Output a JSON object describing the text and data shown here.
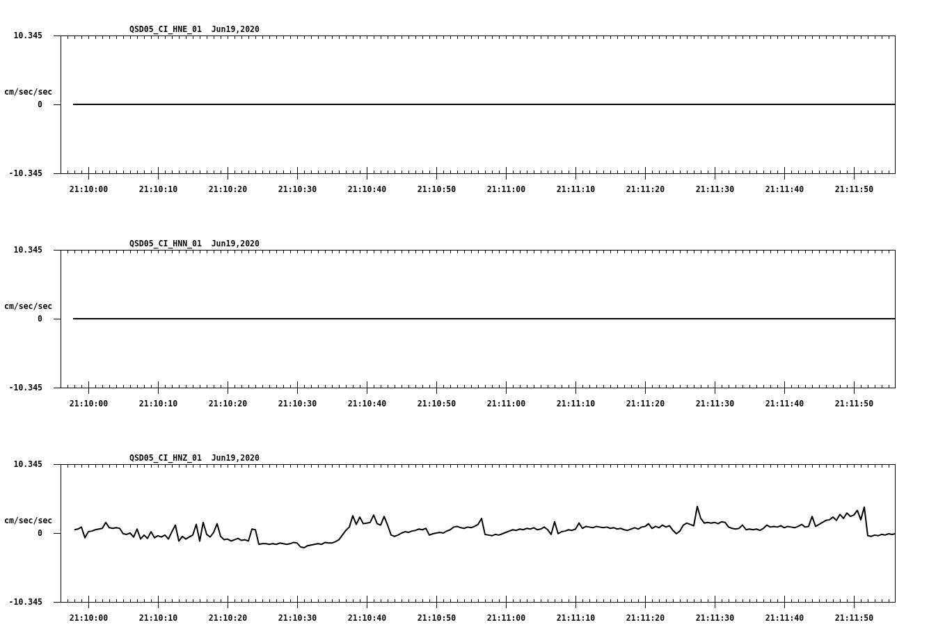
{
  "charts": [
    {
      "chart_data": {
        "type": "line",
        "title": "QSD05_CI_HNE_01  Jun19,2020",
        "ylabel": "cm/sec/sec",
        "x": [
          76197.8,
          76200,
          76210,
          76220,
          76230,
          76240,
          76250,
          76260,
          76270,
          76280,
          76290,
          76300,
          76310,
          76315.9
        ],
        "values": [
          0,
          0,
          0,
          0,
          0,
          0,
          0,
          0,
          0,
          0,
          0,
          0,
          0,
          0
        ],
        "xlim": [
          76196,
          76315.9
        ],
        "ylim": [
          -10.345,
          10.345
        ],
        "xticks": [
          {
            "value": 76200,
            "label": "21:10:00"
          },
          {
            "value": 76210,
            "label": "21:10:10"
          },
          {
            "value": 76220,
            "label": "21:10:20"
          },
          {
            "value": 76230,
            "label": "21:10:30"
          },
          {
            "value": 76240,
            "label": "21:10:40"
          },
          {
            "value": 76250,
            "label": "21:10:50"
          },
          {
            "value": 76260,
            "label": "21:11:00"
          },
          {
            "value": 76270,
            "label": "21:11:10"
          },
          {
            "value": 76280,
            "label": "21:11:20"
          },
          {
            "value": 76290,
            "label": "21:11:30"
          },
          {
            "value": 76300,
            "label": "21:11:40"
          },
          {
            "value": 76310,
            "label": "21:11:50"
          }
        ],
        "yticks": [
          {
            "value": 10.345,
            "label": "10.345"
          },
          {
            "value": 0,
            "label": "0"
          },
          {
            "value": -10.345,
            "label": "-10.345"
          }
        ]
      }
    },
    {
      "chart_data": {
        "type": "line",
        "title": "QSD05_CI_HNN_01  Jun19,2020",
        "ylabel": "cm/sec/sec",
        "x": [
          76197.8,
          76200,
          76210,
          76220,
          76230,
          76240,
          76250,
          76260,
          76270,
          76280,
          76290,
          76300,
          76310,
          76315.9
        ],
        "values": [
          0,
          0,
          0,
          0,
          0,
          0,
          0,
          0,
          0,
          0,
          0,
          0,
          0,
          0
        ],
        "xlim": [
          76196,
          76315.9
        ],
        "ylim": [
          -10.345,
          10.345
        ],
        "xticks": [
          {
            "value": 76200,
            "label": "21:10:00"
          },
          {
            "value": 76210,
            "label": "21:10:10"
          },
          {
            "value": 76220,
            "label": "21:10:20"
          },
          {
            "value": 76230,
            "label": "21:10:30"
          },
          {
            "value": 76240,
            "label": "21:10:40"
          },
          {
            "value": 76250,
            "label": "21:10:50"
          },
          {
            "value": 76260,
            "label": "21:11:00"
          },
          {
            "value": 76270,
            "label": "21:11:10"
          },
          {
            "value": 76280,
            "label": "21:11:20"
          },
          {
            "value": 76290,
            "label": "21:11:30"
          },
          {
            "value": 76300,
            "label": "21:11:40"
          },
          {
            "value": 76310,
            "label": "21:11:50"
          }
        ],
        "yticks": [
          {
            "value": 10.345,
            "label": "10.345"
          },
          {
            "value": 0,
            "label": "0"
          },
          {
            "value": -10.345,
            "label": "-10.345"
          }
        ]
      }
    },
    {
      "chart_data": {
        "type": "line",
        "title": "QSD05_CI_HNZ_01  Jun19,2020",
        "ylabel": "cm/sec/sec",
        "x": [
          76198,
          76198.5,
          76199,
          76199.5,
          76200,
          76200.5,
          76201,
          76201.5,
          76202,
          76202.5,
          76203,
          76203.5,
          76204,
          76204.5,
          76205,
          76205.5,
          76206,
          76206.5,
          76207,
          76207.5,
          76208,
          76208.5,
          76209,
          76209.5,
          76210,
          76210.5,
          76211,
          76211.5,
          76212,
          76212.5,
          76213,
          76213.5,
          76214,
          76214.5,
          76215,
          76215.5,
          76216,
          76216.5,
          76217,
          76217.5,
          76218,
          76218.5,
          76219,
          76219.5,
          76220,
          76220.5,
          76221,
          76221.5,
          76222,
          76222.5,
          76223,
          76223.5,
          76224,
          76224.5,
          76225,
          76225.5,
          76226,
          76226.5,
          76227,
          76227.5,
          76228,
          76228.5,
          76229,
          76229.5,
          76230,
          76230.5,
          76231,
          76231.5,
          76232,
          76232.5,
          76233,
          76233.5,
          76234,
          76234.5,
          76235,
          76235.5,
          76236,
          76236.5,
          76237,
          76237.5,
          76238,
          76238.5,
          76239,
          76239.5,
          76240,
          76240.5,
          76241,
          76241.5,
          76242,
          76242.5,
          76243,
          76243.5,
          76244,
          76244.5,
          76245,
          76245.5,
          76246,
          76246.5,
          76247,
          76247.5,
          76248,
          76248.5,
          76249,
          76249.5,
          76250,
          76250.5,
          76251,
          76251.5,
          76252,
          76252.5,
          76253,
          76253.5,
          76254,
          76254.5,
          76255,
          76255.5,
          76256,
          76256.5,
          76257,
          76257.5,
          76258,
          76258.5,
          76259,
          76259.5,
          76260,
          76260.5,
          76261,
          76261.5,
          76262,
          76262.5,
          76263,
          76263.5,
          76264,
          76264.5,
          76265,
          76265.5,
          76266,
          76266.5,
          76267,
          76267.5,
          76268,
          76268.5,
          76269,
          76269.5,
          76270,
          76270.5,
          76271,
          76271.5,
          76272,
          76272.5,
          76273,
          76273.5,
          76274,
          76274.5,
          76275,
          76275.5,
          76276,
          76276.5,
          76277,
          76277.5,
          76278,
          76278.5,
          76279,
          76279.5,
          76280,
          76280.5,
          76281,
          76281.5,
          76282,
          76282.5,
          76283,
          76283.5,
          76284,
          76284.5,
          76285,
          76285.5,
          76286,
          76286.5,
          76287,
          76287.5,
          76288,
          76288.5,
          76289,
          76289.5,
          76290,
          76290.5,
          76291,
          76291.5,
          76292,
          76292.5,
          76293,
          76293.5,
          76294,
          76294.5,
          76295,
          76295.5,
          76296,
          76296.5,
          76297,
          76297.5,
          76298,
          76298.5,
          76299,
          76299.5,
          76300,
          76300.5,
          76301,
          76301.5,
          76302,
          76302.5,
          76303,
          76303.5,
          76304,
          76304.5,
          76305,
          76305.5,
          76306,
          76306.5,
          76307,
          76307.5,
          76308,
          76308.5,
          76309,
          76309.5,
          76310,
          76310.5,
          76311,
          76311.5,
          76312,
          76312.5,
          76313,
          76313.5,
          76314,
          76314.5,
          76315,
          76315.5,
          76315.9
        ],
        "values": [
          0.5,
          0.6,
          0.9,
          -0.7,
          0.2,
          0.3,
          0.5,
          0.6,
          0.7,
          1.6,
          0.8,
          0.7,
          0.8,
          0.7,
          -0.1,
          -0.2,
          0.0,
          -0.6,
          0.6,
          -0.9,
          -0.3,
          -0.8,
          0.2,
          -0.7,
          -0.4,
          -0.6,
          -0.3,
          -0.9,
          0.2,
          1.2,
          -1.2,
          -0.5,
          -0.9,
          -0.6,
          -0.3,
          1.3,
          -1.2,
          1.6,
          -0.2,
          -0.6,
          0.1,
          1.4,
          -0.5,
          -1.0,
          -0.9,
          -1.2,
          -1.0,
          -0.8,
          -1.1,
          -1.0,
          -1.2,
          0.6,
          0.5,
          -1.7,
          -1.6,
          -1.6,
          -1.7,
          -1.6,
          -1.7,
          -1.5,
          -1.6,
          -1.7,
          -1.6,
          -1.4,
          -1.5,
          -2.1,
          -2.2,
          -1.9,
          -1.8,
          -1.7,
          -1.6,
          -1.7,
          -1.4,
          -1.5,
          -1.5,
          -1.3,
          -1.0,
          -0.3,
          0.4,
          0.9,
          2.6,
          1.3,
          2.4,
          1.4,
          1.5,
          1.6,
          2.7,
          1.4,
          1.2,
          2.5,
          1.2,
          -0.3,
          -0.5,
          -0.3,
          0.0,
          0.2,
          0.1,
          0.3,
          0.4,
          0.6,
          0.5,
          0.7,
          -0.3,
          -0.1,
          0.0,
          0.1,
          0.0,
          0.3,
          0.5,
          0.9,
          1.0,
          0.8,
          0.7,
          0.9,
          0.8,
          1.0,
          1.3,
          2.2,
          -0.2,
          -0.3,
          -0.4,
          -0.2,
          -0.3,
          -0.1,
          0.1,
          0.3,
          0.5,
          0.4,
          0.6,
          0.5,
          0.7,
          0.6,
          0.8,
          0.5,
          0.6,
          0.9,
          0.5,
          -0.2,
          1.7,
          -0.1,
          0.2,
          0.3,
          0.5,
          0.4,
          0.6,
          1.5,
          0.7,
          1.0,
          0.9,
          0.8,
          1.0,
          0.9,
          0.8,
          0.9,
          0.7,
          0.8,
          0.6,
          0.7,
          0.5,
          0.4,
          0.6,
          0.8,
          0.6,
          0.9,
          1.0,
          1.4,
          0.7,
          1.0,
          0.8,
          1.2,
          0.9,
          1.1,
          0.4,
          -0.1,
          0.3,
          1.2,
          1.5,
          1.3,
          1.1,
          4.0,
          2.2,
          1.5,
          1.6,
          1.5,
          1.6,
          1.4,
          1.7,
          1.6,
          0.9,
          0.7,
          0.6,
          0.7,
          1.2,
          0.5,
          0.6,
          0.5,
          0.6,
          0.4,
          0.7,
          1.2,
          0.9,
          1.0,
          0.9,
          1.1,
          0.8,
          1.0,
          0.9,
          0.8,
          1.0,
          1.3,
          0.9,
          1.0,
          2.5,
          1.0,
          1.3,
          1.6,
          1.9,
          2.0,
          2.4,
          1.9,
          2.8,
          2.2,
          3.0,
          2.5,
          2.7,
          3.4,
          2.0,
          3.9,
          -0.4,
          -0.5,
          -0.3,
          -0.4,
          -0.2,
          -0.3,
          -0.1,
          -0.2,
          -0.1
        ],
        "xlim": [
          76196,
          76315.9
        ],
        "ylim": [
          -10.345,
          10.345
        ],
        "xticks": [
          {
            "value": 76200,
            "label": "21:10:00"
          },
          {
            "value": 76210,
            "label": "21:10:10"
          },
          {
            "value": 76220,
            "label": "21:10:20"
          },
          {
            "value": 76230,
            "label": "21:10:30"
          },
          {
            "value": 76240,
            "label": "21:10:40"
          },
          {
            "value": 76250,
            "label": "21:10:50"
          },
          {
            "value": 76260,
            "label": "21:11:00"
          },
          {
            "value": 76270,
            "label": "21:11:10"
          },
          {
            "value": 76280,
            "label": "21:11:20"
          },
          {
            "value": 76290,
            "label": "21:11:30"
          },
          {
            "value": 76300,
            "label": "21:11:40"
          },
          {
            "value": 76310,
            "label": "21:11:50"
          }
        ],
        "yticks": [
          {
            "value": 10.345,
            "label": "10.345"
          },
          {
            "value": 0,
            "label": "0"
          },
          {
            "value": -10.345,
            "label": "-10.345"
          }
        ]
      }
    }
  ]
}
